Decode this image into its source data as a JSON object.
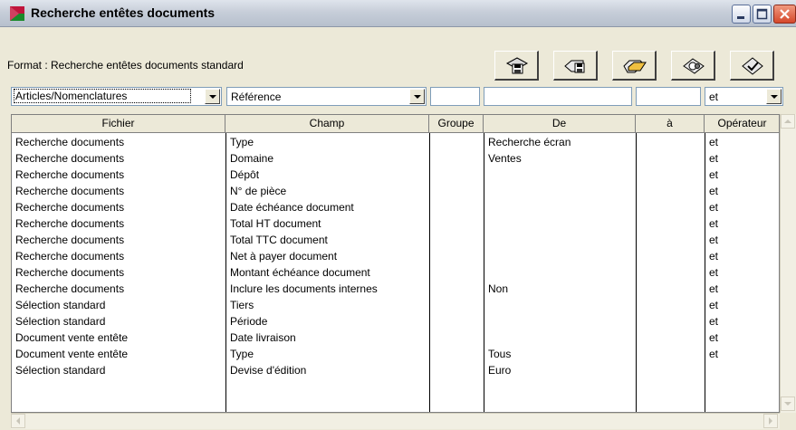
{
  "window": {
    "title": "Recherche entêtes documents"
  },
  "format": {
    "label": "Format : Recherche entêtes documents standard"
  },
  "toolbar": {
    "buttons": [
      "save-format-icon",
      "save-as-format-icon",
      "open-format-icon",
      "refresh-format-icon",
      "validate-icon"
    ]
  },
  "filter": {
    "fichier": "Articles/Nomenclatures",
    "champ": "Référence",
    "groupe": "",
    "de": "",
    "a": "",
    "operateur": "et"
  },
  "table": {
    "columns": [
      "Fichier",
      "Champ",
      "Groupe",
      "De",
      "à",
      "Opérateur"
    ],
    "rows": [
      [
        "Recherche documents",
        "Type",
        "",
        "Recherche écran",
        "",
        "et"
      ],
      [
        "Recherche documents",
        "Domaine",
        "",
        "Ventes",
        "",
        "et"
      ],
      [
        "Recherche documents",
        "Dépôt",
        "",
        "",
        "",
        "et"
      ],
      [
        "Recherche documents",
        "N° de pièce",
        "",
        "",
        "",
        "et"
      ],
      [
        "Recherche documents",
        "Date échéance document",
        "",
        "",
        "",
        "et"
      ],
      [
        "Recherche documents",
        "Total HT document",
        "",
        "",
        "",
        "et"
      ],
      [
        "Recherche documents",
        "Total TTC document",
        "",
        "",
        "",
        "et"
      ],
      [
        "Recherche documents",
        "Net à payer document",
        "",
        "",
        "",
        "et"
      ],
      [
        "Recherche documents",
        "Montant échéance document",
        "",
        "",
        "",
        "et"
      ],
      [
        "Recherche documents",
        "Inclure les documents internes",
        "",
        "Non",
        "",
        "et"
      ],
      [
        "Sélection standard",
        "Tiers",
        "",
        "",
        "",
        "et"
      ],
      [
        "Sélection standard",
        "Période",
        "",
        "",
        "",
        "et"
      ],
      [
        "Document vente entête",
        "Date livraison",
        "",
        "",
        "",
        "et"
      ],
      [
        "Document vente entête",
        "Type",
        "",
        "Tous",
        "",
        "et"
      ],
      [
        "Sélection standard",
        "Devise d'édition",
        "",
        "Euro",
        "",
        ""
      ]
    ]
  }
}
